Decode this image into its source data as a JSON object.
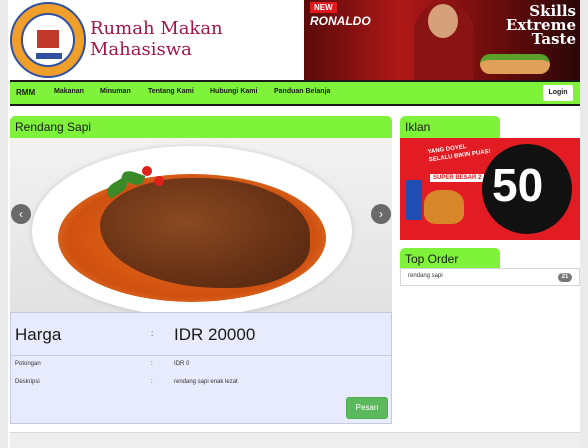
{
  "site": {
    "title": "Rumah Makan Mahasiswa",
    "logo_icon": "university-logo-icon"
  },
  "banner_ad": {
    "tag": "NEW",
    "brand": "RONALDO",
    "headline": "Skills Extreme Taste"
  },
  "nav": {
    "brand": "RMM",
    "items": [
      {
        "label": "Makanan"
      },
      {
        "label": "Minuman"
      },
      {
        "label": "Tentang Kami"
      },
      {
        "label": "Hubungi Kami"
      },
      {
        "label": "Panduan Belanja"
      }
    ],
    "login_label": "Login"
  },
  "product": {
    "heading": "Rendang Sapi",
    "image_icon": "rendang-dish-photo",
    "prev_icon": "chevron-left-icon",
    "next_icon": "chevron-right-icon",
    "price_label": "Harga",
    "price_value": "IDR 20000",
    "separator": ":",
    "rows": [
      {
        "label": "Potongan",
        "value": "IDR 0"
      },
      {
        "label": "Deskripsi",
        "value": "rendang sapi enak lezat"
      }
    ],
    "order_label": "Pesan"
  },
  "sidebar": {
    "iklan_heading": "Iklan",
    "iklan_ad": {
      "big_text": "50",
      "caption": "YANG DOYEL SELALU BIKIN PUAS!",
      "sub": "SUPER BESAR 2"
    },
    "top_order_heading": "Top Order",
    "top_orders": [
      {
        "name": "rendang sapi",
        "count": "21"
      }
    ]
  },
  "colors": {
    "accent_green": "#7ff23a",
    "title_color": "#a3164a",
    "order_button": "#5cb85c",
    "detail_background": "#e8ebfb"
  }
}
